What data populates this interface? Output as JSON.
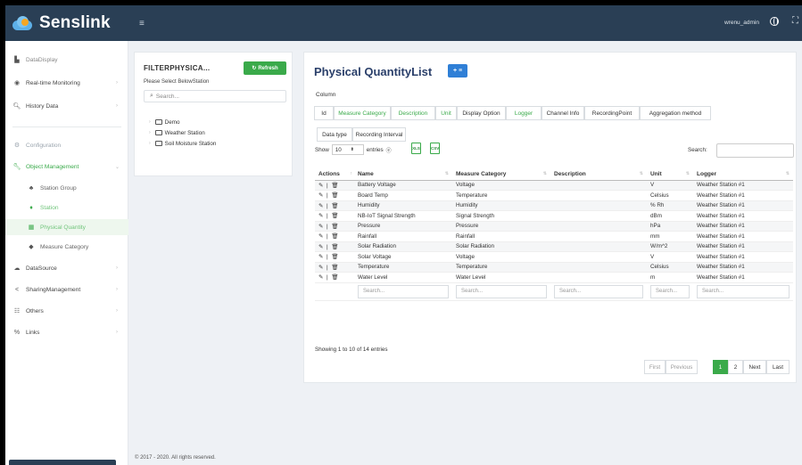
{
  "brand": {
    "name": "Senslink"
  },
  "header": {
    "username": "wrenu_admin",
    "menu_icon": "hamburger-icon",
    "globe_icon": "globe-icon",
    "expand_icon": "expand-icon"
  },
  "sidebar": {
    "items": [
      {
        "label": "DataDisplay",
        "icon": "chart-bar-icon"
      },
      {
        "label": "Real-time Monitoring",
        "icon": "eye-icon"
      },
      {
        "label": "History Data",
        "icon": "search-icon"
      },
      {
        "label": "Configuration",
        "icon": "gears-icon"
      },
      {
        "label": "Object Management",
        "icon": "wrench-icon"
      },
      {
        "label": "Station Group",
        "icon": "sitemap-icon"
      },
      {
        "label": "Station",
        "icon": "map-marker-icon"
      },
      {
        "label": "Physical Quantity",
        "icon": "table-icon"
      },
      {
        "label": "Measure Category",
        "icon": "tag-icon"
      },
      {
        "label": "DataSource",
        "icon": "cloud-icon"
      },
      {
        "label": "SharingManagement",
        "icon": "share-icon"
      },
      {
        "label": "Others",
        "icon": "sliders-icon"
      },
      {
        "label": "Links",
        "icon": "link-icon"
      }
    ]
  },
  "filter": {
    "title": "FILTERPHYSICA...",
    "refresh_label": "Refresh",
    "subtitle": "Please Select BelowStation",
    "search_placeholder": "Search...",
    "tree": [
      "Demo",
      "Weather Station",
      "Soil Moisture Station"
    ]
  },
  "main": {
    "title": "Physical QuantityList",
    "add_label": "+ ≡",
    "column_label": "Column",
    "column_buttons": [
      "Id",
      "Measure Category",
      "Description",
      "Unit",
      "Display Option",
      "Logger",
      "Channel Info",
      "RecordingPoint",
      "Aggregation method",
      "Data type",
      "Recording Interval"
    ],
    "show_label": "Show",
    "show_value": "10",
    "entries_label": "entries",
    "export_labels": [
      "XLS",
      "CSV"
    ],
    "search_label": "Search:",
    "table": {
      "headers": [
        "Actions",
        "Name",
        "Measure Category",
        "Description",
        "Unit",
        "Logger"
      ],
      "action_text": "✎ | 🗑",
      "rows": [
        {
          "name": "Battery Voltage",
          "category": "Voltage",
          "description": "",
          "unit": "V",
          "logger": "Weather Station #1"
        },
        {
          "name": "Board Temp",
          "category": "Temperature",
          "description": "",
          "unit": "Celsius",
          "logger": "Weather Station #1"
        },
        {
          "name": "Humidity",
          "category": "Humidity",
          "description": "",
          "unit": "% Rh",
          "logger": "Weather Station #1"
        },
        {
          "name": "NB-IoT Signal Strength",
          "category": "Signal Strength",
          "description": "",
          "unit": "dBm",
          "logger": "Weather Station #1"
        },
        {
          "name": "Pressure",
          "category": "Pressure",
          "description": "",
          "unit": "hPa",
          "logger": "Weather Station #1"
        },
        {
          "name": "Rainfall",
          "category": "Rainfall",
          "description": "",
          "unit": "mm",
          "logger": "Weather Station #1"
        },
        {
          "name": "Solar Radiation",
          "category": "Solar Radiation",
          "description": "",
          "unit": "W/m^2",
          "logger": "Weather Station #1"
        },
        {
          "name": "Solar Voltage",
          "category": "Voltage",
          "description": "",
          "unit": "V",
          "logger": "Weather Station #1"
        },
        {
          "name": "Temperature",
          "category": "Temperature",
          "description": "",
          "unit": "Celsius",
          "logger": "Weather Station #1"
        },
        {
          "name": "Water Level",
          "category": "Water Level",
          "description": "",
          "unit": "m",
          "logger": "Weather Station #1"
        }
      ],
      "filter_placeholders": [
        "Search...",
        "Search...",
        "Search...",
        "Search...",
        "Search..."
      ]
    },
    "info": "Showing 1 to 10 of 14 entries",
    "pagination": [
      "First",
      "Previous",
      "1",
      "2",
      "Next",
      "Last"
    ]
  },
  "footer": {
    "text": "© 2017 - 2020. All rights reserved."
  },
  "colors": {
    "topbar": "#2a3f55",
    "accent_green": "#3aaa4a",
    "title_navy": "#2a3f6a",
    "add_blue": "#2f7fd6"
  }
}
